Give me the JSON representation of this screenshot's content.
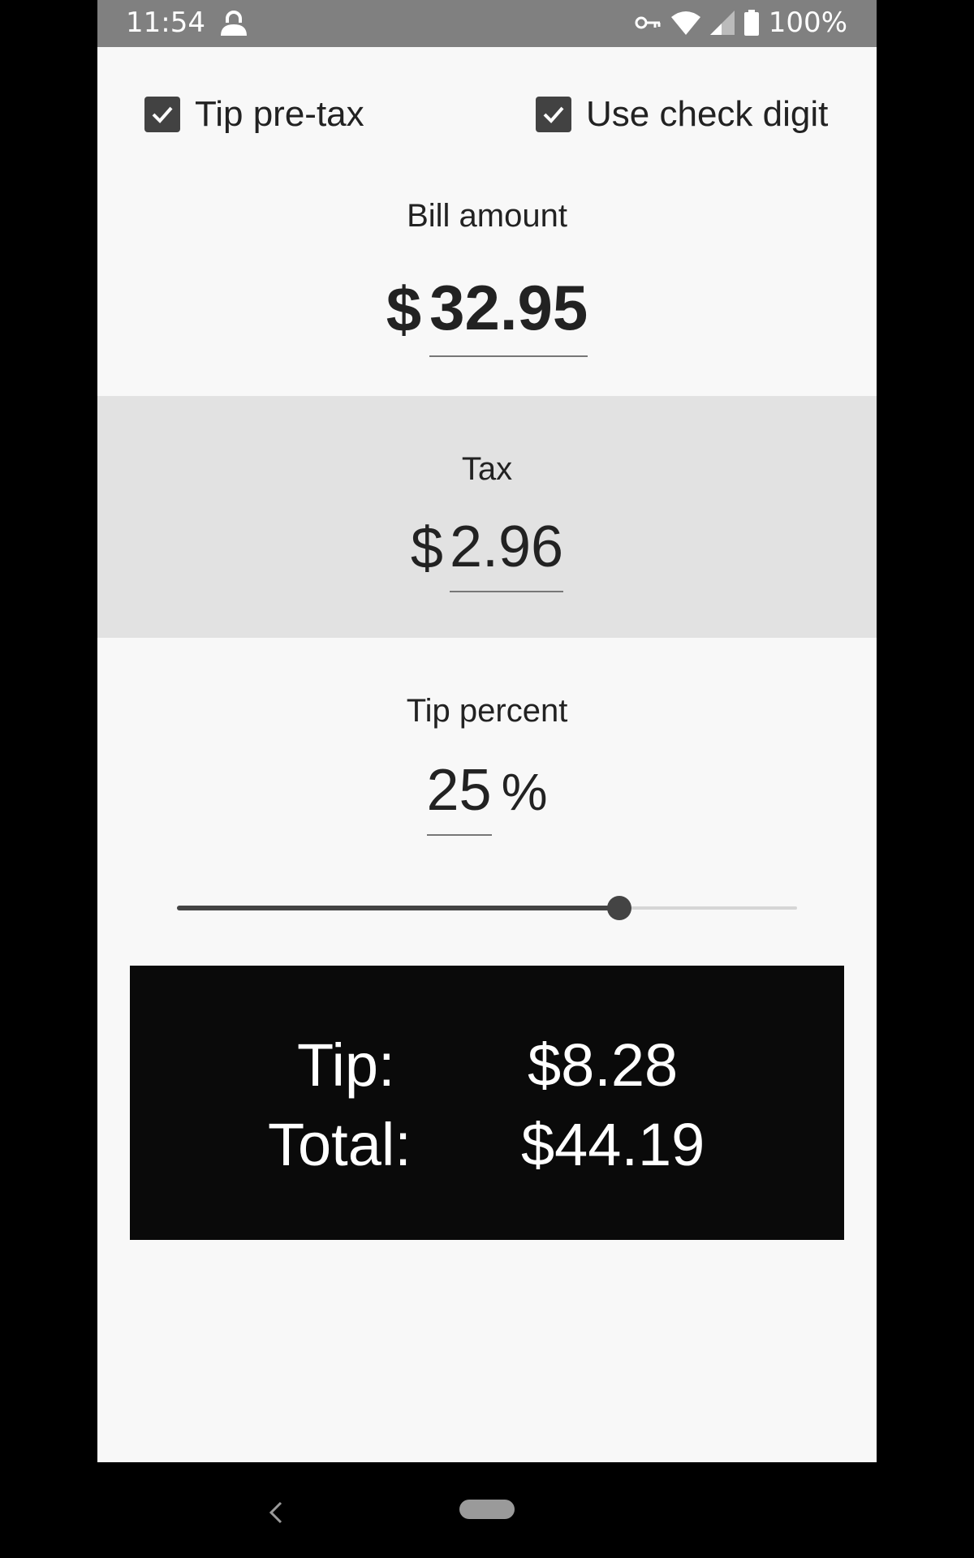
{
  "status_bar": {
    "time": "11:54",
    "battery": "100%",
    "icons": [
      "lock-icon",
      "key-icon",
      "wifi-icon",
      "signal-icon",
      "battery-icon"
    ]
  },
  "options": {
    "tip_pre_tax": {
      "label": "Tip pre-tax",
      "checked": true
    },
    "use_check_digit": {
      "label": "Use check digit",
      "checked": true
    }
  },
  "bill": {
    "label": "Bill amount",
    "currency": "$",
    "value": "32.95"
  },
  "tax": {
    "label": "Tax",
    "currency": "$",
    "value": "2.96"
  },
  "tip": {
    "label": "Tip percent",
    "value": "25",
    "suffix": "%",
    "slider_fraction": 0.714
  },
  "results": {
    "tip_label": "Tip:",
    "tip_value": "$8.28",
    "total_label": "Total:",
    "total_value": "$44.19"
  },
  "colors": {
    "status_bar": "#808080",
    "background": "#f8f8f8",
    "tax_band": "#e2e2e2",
    "results_bg": "#0a0a0a",
    "accent": "#424242"
  }
}
